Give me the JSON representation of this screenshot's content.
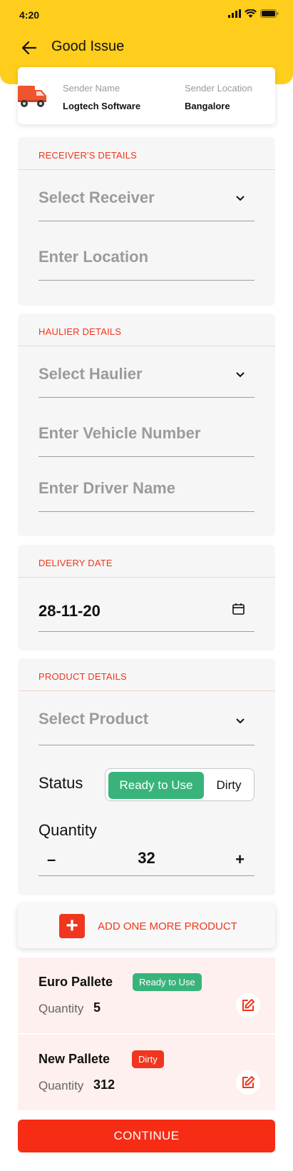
{
  "status_bar": {
    "time": "4:20"
  },
  "header": {
    "title": "Good Issue",
    "bg_color": "#FFCD1C"
  },
  "sender": {
    "name_label": "Sender Name",
    "name_value": "Logtech Software",
    "location_label": "Sender Location",
    "location_value": "Bangalore"
  },
  "receiver": {
    "title": "RECEIVER'S DETAILS",
    "select_placeholder": "Select Receiver",
    "location_placeholder": "Enter Location"
  },
  "haulier": {
    "title": "HAULIER DETAILS",
    "select_placeholder": "Select Haulier",
    "vehicle_placeholder": "Enter Vehicle Number",
    "driver_placeholder": "Enter Driver Name"
  },
  "delivery": {
    "title": "DELIVERY DATE",
    "date_value": "28-11-20"
  },
  "product": {
    "title": "PRODUCT DETAILS",
    "select_placeholder": "Select Product",
    "status_label": "Status",
    "status_options": [
      "Ready to Use",
      "Dirty"
    ],
    "status_selected": "Ready to Use",
    "quantity_label": "Quantity",
    "quantity_value": "32",
    "minus": "–",
    "plus": "+"
  },
  "add_more": {
    "label": "ADD ONE MORE PRODUCT",
    "icon": "+"
  },
  "products": [
    {
      "name": "Euro Pallete",
      "status": "Ready to Use",
      "status_color": "#38B47A",
      "qty_label": "Quantity",
      "qty": "5"
    },
    {
      "name": "New Pallete",
      "status": "Dirty",
      "status_color": "#F0361E",
      "qty_label": "Quantity",
      "qty": "312"
    }
  ],
  "continue_label": "CONTINUE",
  "colors": {
    "accent": "#F0361E",
    "success": "#38B47A",
    "primary_button": "#F72C15"
  }
}
